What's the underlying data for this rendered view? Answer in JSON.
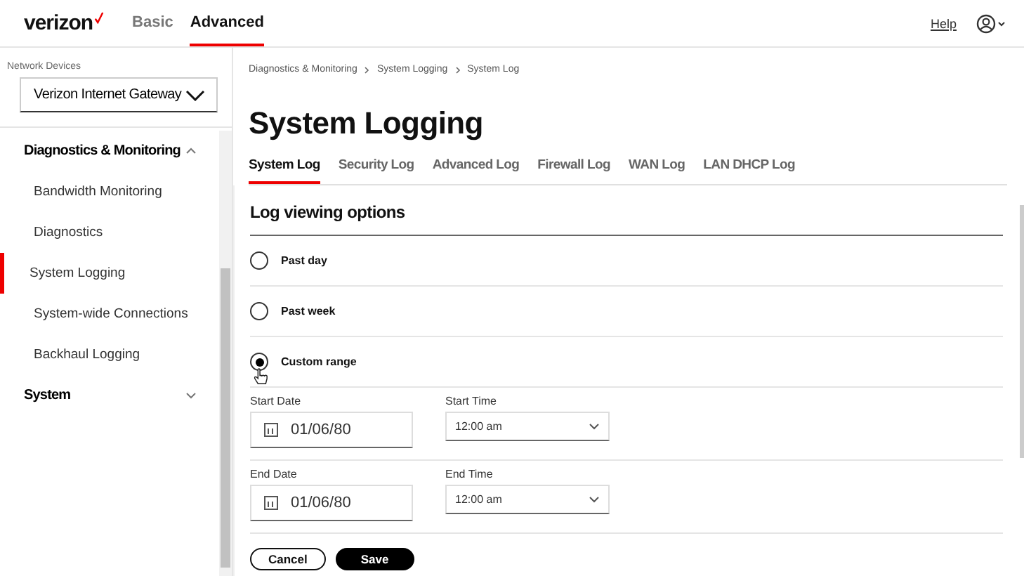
{
  "header": {
    "logo": "verizon",
    "modes": [
      {
        "label": "Basic",
        "selected": false
      },
      {
        "label": "Advanced",
        "selected": true
      }
    ],
    "help": "Help"
  },
  "sidebar": {
    "devices_label": "Network Devices",
    "device": "Verizon Internet Gateway",
    "sections": [
      {
        "label": "Diagnostics & Monitoring",
        "expanded": true,
        "items": [
          {
            "label": "Bandwidth Monitoring",
            "selected": false
          },
          {
            "label": "Diagnostics",
            "selected": false
          },
          {
            "label": "System Logging",
            "selected": true
          },
          {
            "label": "System-wide Connections",
            "selected": false
          },
          {
            "label": "Backhaul Logging",
            "selected": false
          }
        ]
      },
      {
        "label": "System",
        "expanded": false
      }
    ]
  },
  "breadcrumb": [
    "Diagnostics & Monitoring",
    "System Logging",
    "System Log"
  ],
  "title": "System Logging",
  "tabs": [
    {
      "label": "System Log",
      "selected": true
    },
    {
      "label": "Security Log",
      "selected": false
    },
    {
      "label": "Advanced Log",
      "selected": false
    },
    {
      "label": "Firewall Log",
      "selected": false
    },
    {
      "label": "WAN Log",
      "selected": false
    },
    {
      "label": "LAN DHCP Log",
      "selected": false
    }
  ],
  "section_title": "Log viewing options",
  "options": [
    {
      "label": "Past day",
      "selected": false
    },
    {
      "label": "Past week",
      "selected": false
    },
    {
      "label": "Custom range",
      "selected": true
    }
  ],
  "ranges": [
    {
      "date_label": "Start Date",
      "date": "01/06/80",
      "time_label": "Start Time",
      "time": "12:00 am"
    },
    {
      "date_label": "End Date",
      "date": "01/06/80",
      "time_label": "End Time",
      "time": "12:00 am"
    }
  ],
  "buttons": {
    "cancel": "Cancel",
    "save": "Save"
  }
}
